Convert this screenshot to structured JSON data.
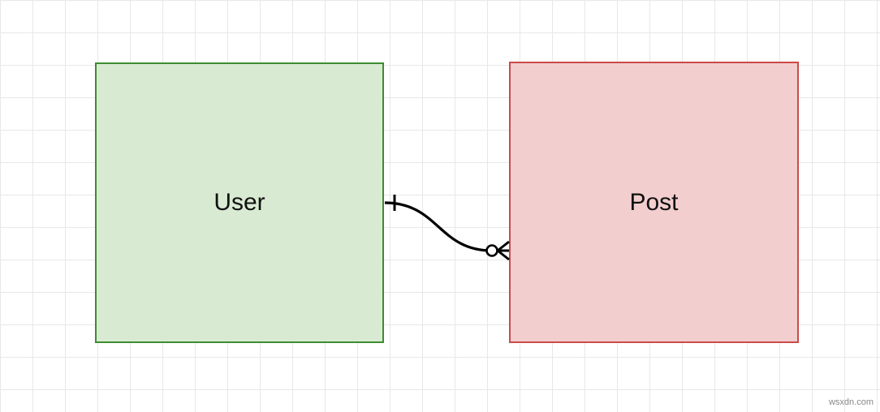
{
  "diagram": {
    "entities": {
      "user": {
        "label": "User"
      },
      "post": {
        "label": "Post"
      }
    },
    "relationship": {
      "from": "user",
      "to": "post",
      "from_cardinality": "one",
      "to_cardinality": "zero-or-many"
    }
  },
  "watermark": "wsxdn.com"
}
